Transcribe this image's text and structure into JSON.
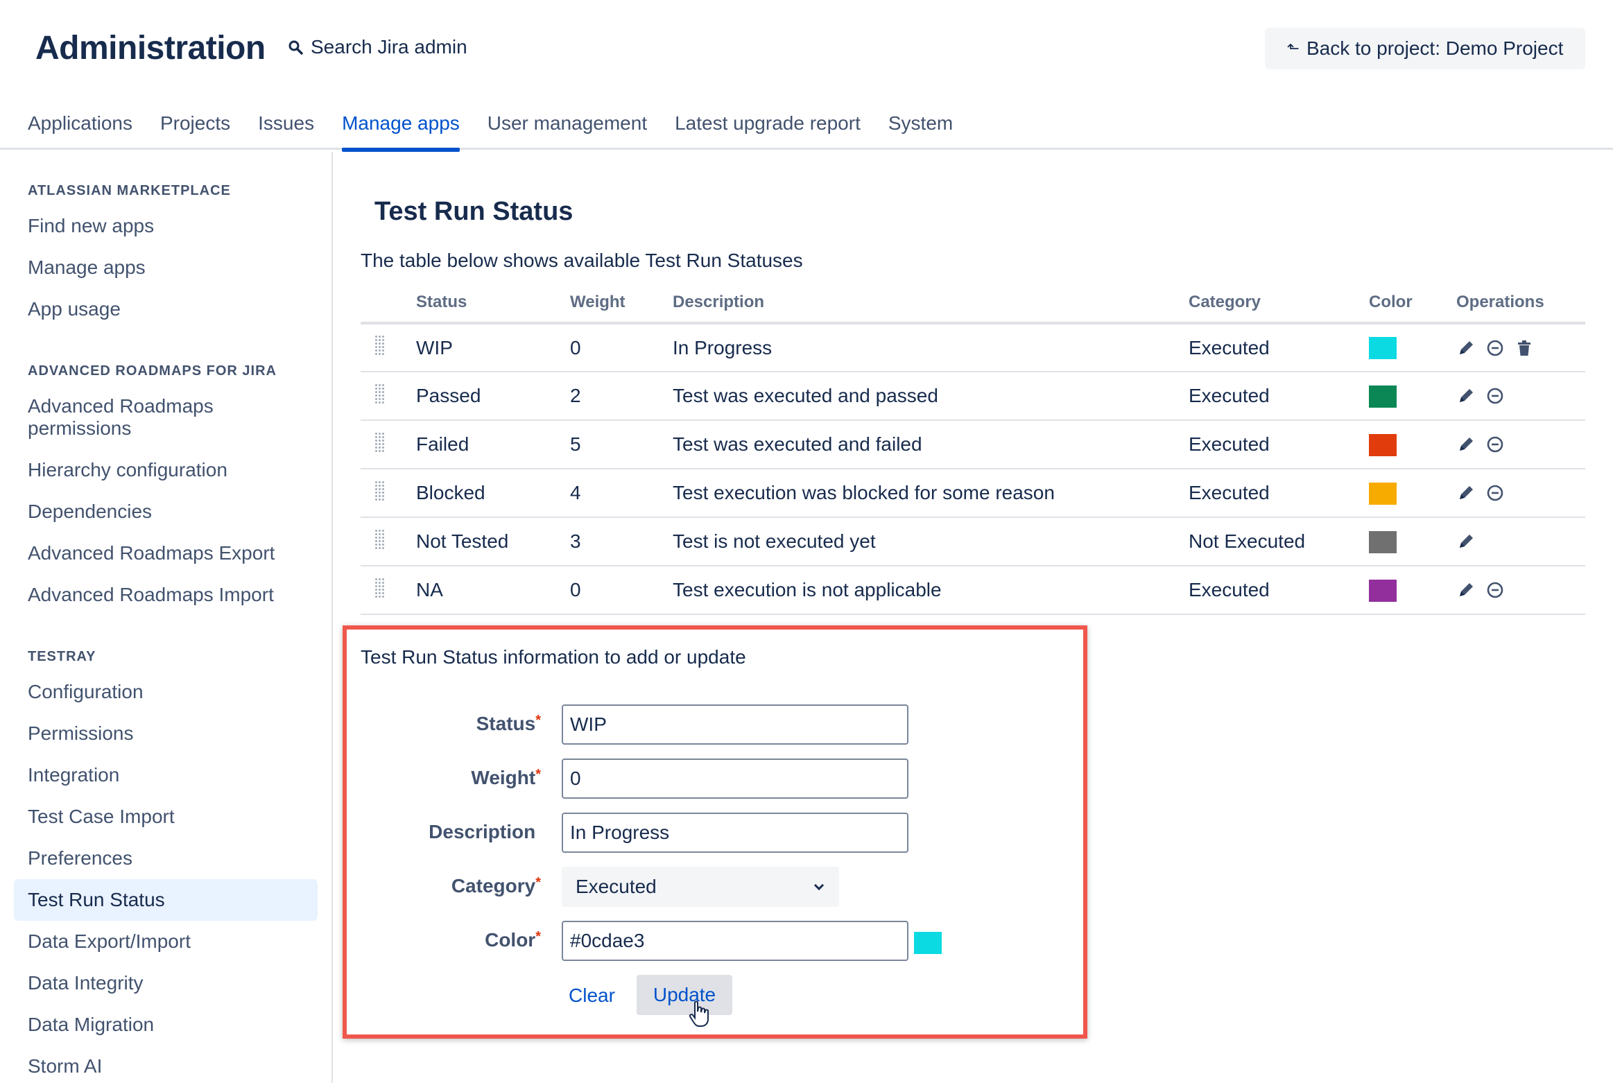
{
  "header": {
    "title": "Administration",
    "search_label": "Search Jira admin",
    "back_label": "Back to project: Demo Project"
  },
  "nav": {
    "tabs": [
      {
        "label": "Applications"
      },
      {
        "label": "Projects"
      },
      {
        "label": "Issues"
      },
      {
        "label": "Manage apps",
        "active": true
      },
      {
        "label": "User management"
      },
      {
        "label": "Latest upgrade report"
      },
      {
        "label": "System"
      }
    ]
  },
  "sidebar": {
    "sections": [
      {
        "heading": "ATLASSIAN MARKETPLACE",
        "items": [
          "Find new apps",
          "Manage apps",
          "App usage"
        ]
      },
      {
        "heading": "ADVANCED ROADMAPS FOR JIRA",
        "items": [
          "Advanced Roadmaps permissions",
          "Hierarchy configuration",
          "Dependencies",
          "Advanced Roadmaps Export",
          "Advanced Roadmaps Import"
        ]
      },
      {
        "heading": "TESTRAY",
        "items": [
          "Configuration",
          "Permissions",
          "Integration",
          "Test Case Import",
          "Preferences",
          "Test Run Status",
          "Data Export/Import",
          "Data Integrity",
          "Data Migration",
          "Storm AI"
        ]
      }
    ],
    "selected": "Test Run Status"
  },
  "main": {
    "title": "Test Run Status",
    "description": "The table below shows available Test Run Statuses",
    "table": {
      "headers": [
        "Status",
        "Weight",
        "Description",
        "Category",
        "Color",
        "Operations"
      ],
      "rows": [
        {
          "status": "WIP",
          "weight": "0",
          "description": "In Progress",
          "category": "Executed",
          "color": "#0cdae3",
          "ops": [
            "edit",
            "disable",
            "delete"
          ]
        },
        {
          "status": "Passed",
          "weight": "2",
          "description": "Test was executed and passed",
          "category": "Executed",
          "color": "#0a8754",
          "ops": [
            "edit",
            "disable"
          ]
        },
        {
          "status": "Failed",
          "weight": "5",
          "description": "Test was executed and failed",
          "category": "Executed",
          "color": "#e03c0c",
          "ops": [
            "edit",
            "disable"
          ]
        },
        {
          "status": "Blocked",
          "weight": "4",
          "description": "Test execution was blocked for some reason",
          "category": "Executed",
          "color": "#f7ab00",
          "ops": [
            "edit",
            "disable"
          ]
        },
        {
          "status": "Not Tested",
          "weight": "3",
          "description": "Test is not executed yet",
          "category": "Not Executed",
          "color": "#707070",
          "ops": [
            "edit"
          ]
        },
        {
          "status": "NA",
          "weight": "0",
          "description": "Test execution is not applicable",
          "category": "Executed",
          "color": "#922f9c",
          "ops": [
            "edit",
            "disable"
          ]
        }
      ]
    }
  },
  "form": {
    "heading": "Test Run Status information to add or update",
    "status_label": "Status",
    "status_value": "WIP",
    "weight_label": "Weight",
    "weight_value": "0",
    "description_label": "Description",
    "description_value": "In Progress",
    "category_label": "Category",
    "category_value": "Executed",
    "color_label": "Color",
    "color_value": "#0cdae3",
    "required_mark": "*",
    "clear_label": "Clear",
    "update_label": "Update"
  },
  "icons": {
    "search": "search-icon",
    "back": "back-arrow-icon",
    "drag": "drag-handle-icon",
    "edit": "pencil-icon",
    "disable": "minus-circle-icon",
    "delete": "trash-icon",
    "dropdown": "chevron-down-icon"
  },
  "colors": {
    "accent": "#0052cc",
    "highlight_border": "#f0574c",
    "selected_bg": "#e9f2ff"
  }
}
